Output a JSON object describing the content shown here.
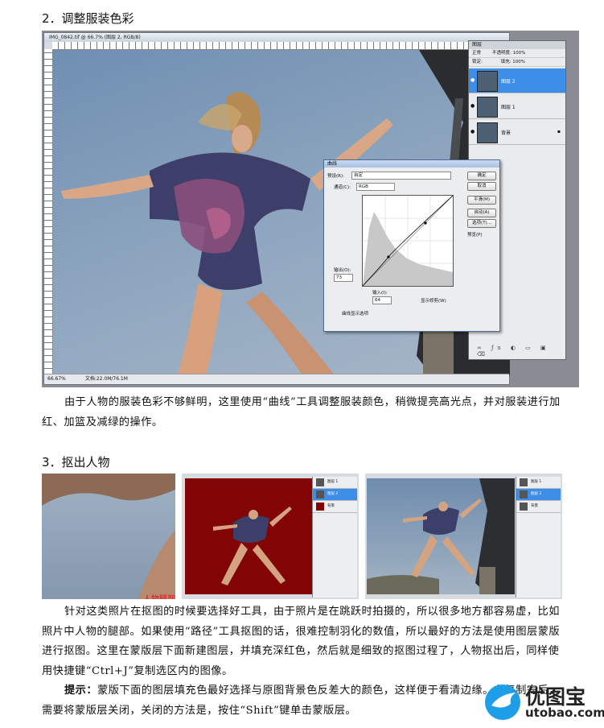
{
  "section2": {
    "heading": "2．调整服装色彩",
    "paragraph": "由于人物的服装色彩不够鲜明，这里使用“曲线”工具调整服装颜色，稍微提亮高光点，并对服装进行加红、加篮及减绿的操作。"
  },
  "screenshot1": {
    "doc_title": "IMG_0842.tif @ 66.7% (图层 2, RGB/8)",
    "status_zoom": "66.67%",
    "status_doc": "文档:22.0M/76.1M",
    "layers_panel": {
      "tab": "图层",
      "mode": "正常",
      "opacity_label": "不透明度:",
      "opacity": "100%",
      "lock_label": "锁定:",
      "fill_label": "填充:",
      "fill": "100%",
      "layers": [
        {
          "name": "图层 2",
          "selected": true
        },
        {
          "name": "图层 1",
          "selected": false
        },
        {
          "name": "背景",
          "selected": false
        }
      ]
    },
    "curves": {
      "title": "曲线",
      "preset_label": "预设(R):",
      "preset_value": "自定",
      "channel_label": "通道(C):",
      "channel_value": "RGB",
      "output_label": "输出(O):",
      "output_value": "73",
      "input_label": "输入(I):",
      "input_value": "64",
      "show_clipping": "显示修剪(W)",
      "curve_display": "曲线显示选项",
      "buttons": [
        "确定",
        "取消",
        "平滑(M)",
        "自动(A)",
        "选项(T)..."
      ],
      "preview": "预览(P)"
    }
  },
  "section3": {
    "heading": "3．抠出人物",
    "image_caption": "人物腿部",
    "small_layers_b": [
      "图层 1",
      "图层 2",
      "背景"
    ],
    "small_layers_c": [
      "图层 1",
      "图层 2",
      "背景"
    ],
    "paragraph1": "针对这类照片在抠图的时候要选择好工具，由于照片是在跳跃时拍摄的，所以很多地方都容易虚，比如照片中人物的腿部。如果使用“路径”工具抠图的话，很难控制羽化的数值，所以最好的方法是使用图层蒙版进行抠图。这里在蒙版层下面新建图层，并填充深红色，然后就是细致的抠图过程了，人物抠出后，同样使用快捷键“Ctrl+J”复制选区内的图像。",
    "tip_label": "提示：",
    "tip_text": "蒙版下面的图层填充色最好选择与原图背景色反差大的颜色，这样便于看清边缘。在复制完后，需要将蒙版层关闭，关闭的方法是，按住“Shift”键单击蒙版层。"
  },
  "watermark": {
    "cn": "优图宝",
    "en": "utobao.com"
  }
}
